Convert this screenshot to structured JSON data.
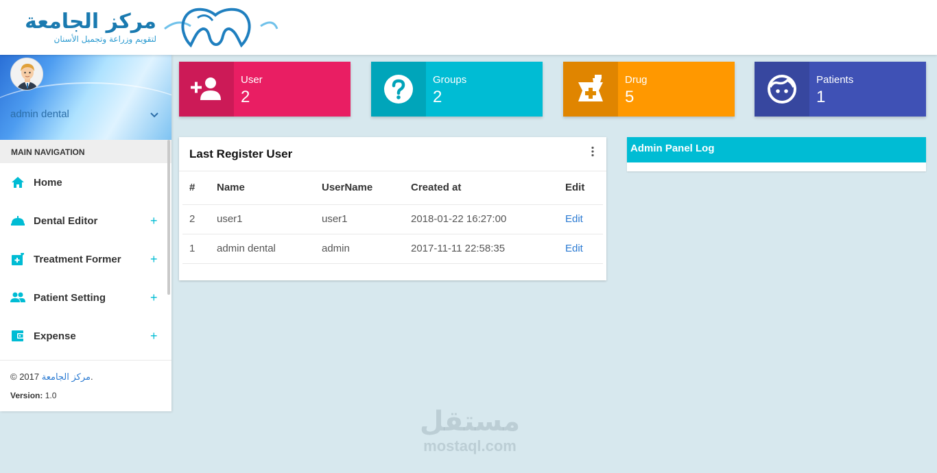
{
  "brand": {
    "logo_text": "مركز الجامعة",
    "logo_subtext": "لتقويم وزراعة وتجميل الأسنان"
  },
  "user_panel": {
    "name": "admin dental"
  },
  "sidebar": {
    "header": "MAIN NAVIGATION",
    "items": [
      {
        "label": "Home",
        "icon": "home-icon",
        "expandable": false
      },
      {
        "label": "Dental Editor",
        "icon": "room-service-icon",
        "expandable": true,
        "plus": "+"
      },
      {
        "label": "Treatment Former",
        "icon": "local-hospital-icon",
        "expandable": true,
        "plus": "+"
      },
      {
        "label": "Patient Setting",
        "icon": "people-icon",
        "expandable": true,
        "plus": "+"
      },
      {
        "label": "Expense",
        "icon": "wallet-icon",
        "expandable": true,
        "plus": "+"
      }
    ],
    "footer": {
      "copyright_prefix": "© 2017 ",
      "copyright_link": "مركز الجامعة",
      "copyright_suffix": ".",
      "version_label": "Version:",
      "version_value": " 1.0"
    }
  },
  "info_boxes": [
    {
      "label": "User",
      "value": "2",
      "color": "#e91e63",
      "icon": "person-add-icon"
    },
    {
      "label": "Groups",
      "value": "2",
      "color": "#00bcd4",
      "icon": "help-icon"
    },
    {
      "label": "Drug",
      "value": "5",
      "color": "#ff9800",
      "icon": "medicine-icon"
    },
    {
      "label": "Patients",
      "value": "1",
      "color": "#3f51b5",
      "icon": "face-icon"
    }
  ],
  "last_register": {
    "title": "Last Register User",
    "columns": [
      "#",
      "Name",
      "UserName",
      "Created at",
      "Edit"
    ],
    "rows": [
      {
        "id": "2",
        "name": "user1",
        "username": "user1",
        "created": "2018-01-22 16:27:00",
        "edit": "Edit"
      },
      {
        "id": "1",
        "name": "admin dental",
        "username": "admin",
        "created": "2017-11-11 22:58:35",
        "edit": "Edit"
      }
    ]
  },
  "admin_log": {
    "title": "Admin Panel Log"
  },
  "watermark": {
    "arabic": "مستقل",
    "latin": "mostaql.com"
  }
}
